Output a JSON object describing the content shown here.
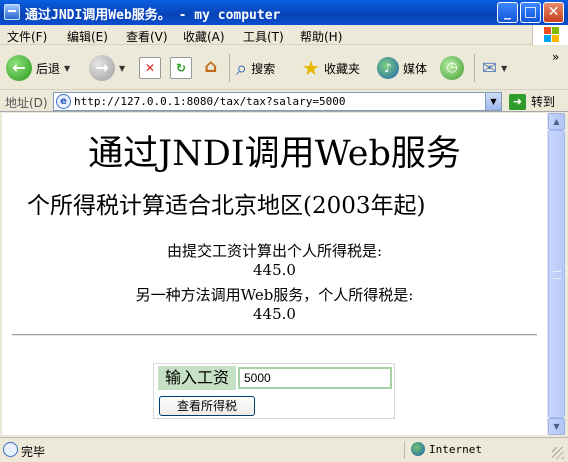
{
  "window": {
    "title": "通过JNDI调用Web服务。 - my computer",
    "minimize": "_",
    "maximize": "□",
    "close": "✕"
  },
  "menu": [
    "文件(F)",
    "编辑(E)",
    "查看(V)",
    "收藏(A)",
    "工具(T)",
    "帮助(H)"
  ],
  "toolbar": {
    "back": "后退",
    "search": "搜索",
    "favorites": "收藏夹",
    "media": "媒体",
    "overflow": "»"
  },
  "address": {
    "label": "地址(D)",
    "url": "http://127.0.0.1:8080/tax/tax?salary=5000",
    "go": "转到"
  },
  "page": {
    "heading": "通过JNDI调用Web服务",
    "subheading": "个所得税计算适合北京地区(2003年起)",
    "line1": "由提交工资计算出个人所得税是:",
    "value1": "445.0",
    "line2": "另一种方法调用Web服务，个人所得税是:",
    "value2": "445.0",
    "form": {
      "label": "输入工资",
      "input_value": "5000",
      "button": "查看所得税"
    }
  },
  "status": {
    "text": "完毕",
    "zone": "Internet"
  }
}
